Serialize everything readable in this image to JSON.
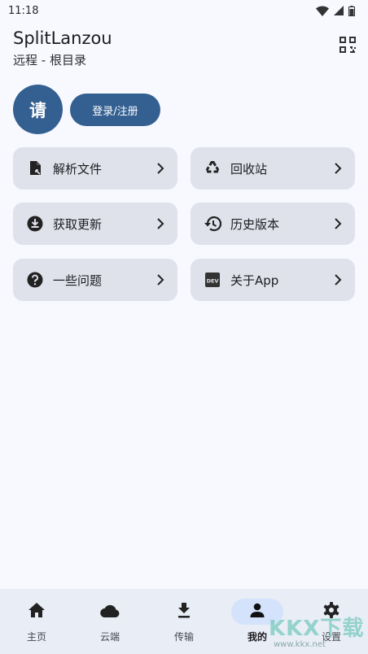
{
  "status_bar": {
    "time": "11:18",
    "icons": [
      "wifi-icon",
      "signal-icon",
      "battery-icon"
    ]
  },
  "header": {
    "title": "SplitLanzou",
    "subtitle": "远程 - 根目录",
    "action_icon": "qr-scan-icon"
  },
  "profile": {
    "avatar_text": "请",
    "login_label": "登录/注册"
  },
  "cards": [
    {
      "label": "解析文件",
      "icon": "file-link-icon"
    },
    {
      "label": "回收站",
      "icon": "recycle-icon"
    },
    {
      "label": "获取更新",
      "icon": "download-circle-icon"
    },
    {
      "label": "历史版本",
      "icon": "history-icon"
    },
    {
      "label": "一些问题",
      "icon": "help-circle-icon"
    },
    {
      "label": "关于App",
      "icon": "dev-icon"
    }
  ],
  "nav": {
    "items": [
      {
        "label": "主页",
        "icon": "home-icon"
      },
      {
        "label": "云端",
        "icon": "cloud-icon"
      },
      {
        "label": "传输",
        "icon": "download-icon"
      },
      {
        "label": "我的",
        "icon": "person-icon",
        "active": true
      },
      {
        "label": "设置",
        "icon": "gear-icon"
      }
    ]
  },
  "watermark": {
    "brand": "KKX下载",
    "url": "www.kkx.net"
  },
  "colors": {
    "primary": "#335f91",
    "card_bg": "#dfe2eb",
    "background": "#f7f9ff",
    "nav_bg": "#e8edf6",
    "nav_active_pill": "#d4e3fb"
  }
}
